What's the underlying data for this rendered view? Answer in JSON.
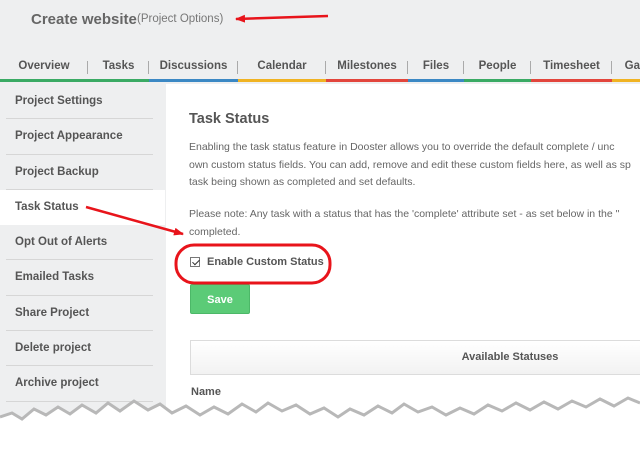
{
  "header": {
    "title": "Create website",
    "subtitle": "(Project Options)"
  },
  "tabs": [
    {
      "label": "Overview",
      "color": "#3aaa64"
    },
    {
      "label": "Tasks",
      "color": "#3aaa64"
    },
    {
      "label": "Discussions",
      "color": "#3b88c4"
    },
    {
      "label": "Calendar",
      "color": "#f0b323"
    },
    {
      "label": "Milestones",
      "color": "#e2453c"
    },
    {
      "label": "Files",
      "color": "#3b88c4"
    },
    {
      "label": "People",
      "color": "#3aaa64"
    },
    {
      "label": "Timesheet",
      "color": "#e2453c"
    },
    {
      "label": "Ga",
      "color": "#f0b323"
    }
  ],
  "sidebar": {
    "items": [
      {
        "label": "Project Settings"
      },
      {
        "label": "Project Appearance"
      },
      {
        "label": "Project Backup"
      },
      {
        "label": "Task Status"
      },
      {
        "label": "Opt Out of Alerts"
      },
      {
        "label": "Emailed Tasks"
      },
      {
        "label": "Share Project"
      },
      {
        "label": "Delete project"
      },
      {
        "label": "Archive project"
      }
    ],
    "active": "Task Status"
  },
  "content": {
    "title": "Task Status",
    "desc_line1": "Enabling the task status feature in Dooster allows you to override the default complete / unc",
    "desc_line2": "own custom status fields. You can add, remove and edit these custom fields here, as well as sp",
    "desc_line3": "task being shown as completed and set defaults.",
    "note_line1": "Please note: Any task with a status that has the 'complete' attribute set - as set below in the \"",
    "note_line2": "completed.",
    "checkbox_label": "Enable Custom Status",
    "checkbox_checked": true,
    "save_label": "Save",
    "statuses_header": "Available Statuses",
    "name_column": "Name"
  },
  "colors": {
    "annotation": "#e8141b",
    "save_button": "#5bcb77"
  }
}
